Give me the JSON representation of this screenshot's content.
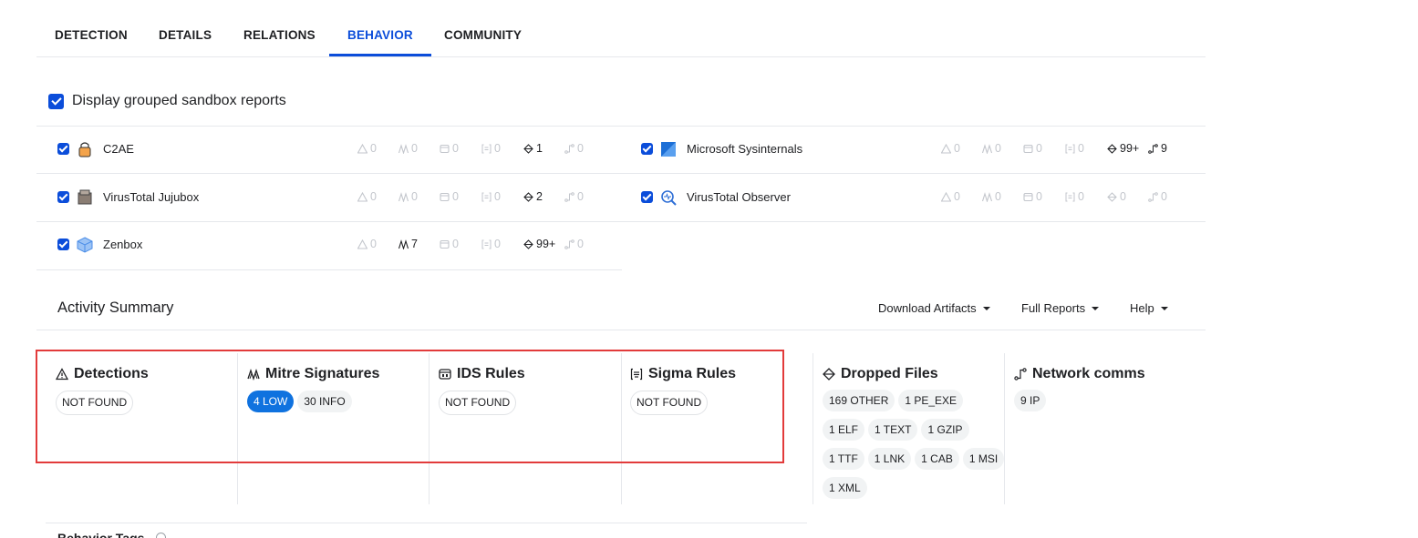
{
  "tabs": [
    {
      "label": "DETECTION",
      "active": false
    },
    {
      "label": "DETAILS",
      "active": false
    },
    {
      "label": "RELATIONS",
      "active": false
    },
    {
      "label": "BEHAVIOR",
      "active": true
    },
    {
      "label": "COMMUNITY",
      "active": false
    }
  ],
  "grouped_reports": {
    "label": "Display grouped sandbox reports",
    "checked": true
  },
  "sandboxes": [
    {
      "name": "C2AE",
      "checked": true,
      "icon": "c2ae-logo-icon",
      "stats": {
        "detections": "0",
        "mitre": "0",
        "ids": "0",
        "sigma": "0",
        "dropped": "1",
        "network": "0"
      }
    },
    {
      "name": "Microsoft Sysinternals",
      "checked": true,
      "icon": "sysinternals-logo-icon",
      "stats": {
        "detections": "0",
        "mitre": "0",
        "ids": "0",
        "sigma": "0",
        "dropped": "99+",
        "network": "9"
      }
    },
    {
      "name": "VirusTotal Jujubox",
      "checked": true,
      "icon": "jujubox-logo-icon",
      "stats": {
        "detections": "0",
        "mitre": "0",
        "ids": "0",
        "sigma": "0",
        "dropped": "2",
        "network": "0"
      }
    },
    {
      "name": "VirusTotal Observer",
      "checked": true,
      "icon": "observer-logo-icon",
      "stats": {
        "detections": "0",
        "mitre": "0",
        "ids": "0",
        "sigma": "0",
        "dropped": "0",
        "network": "0"
      }
    },
    {
      "name": "Zenbox",
      "checked": true,
      "icon": "zenbox-logo-icon",
      "stats": {
        "detections": "0",
        "mitre": "7",
        "ids": "0",
        "sigma": "0",
        "dropped": "99+",
        "network": "0"
      }
    }
  ],
  "activity": {
    "title": "Activity Summary",
    "menus": [
      "Download Artifacts",
      "Full Reports",
      "Help"
    ],
    "columns": {
      "detections": {
        "title": "Detections",
        "pills": [
          "NOT FOUND"
        ]
      },
      "mitre": {
        "title": "Mitre Signatures",
        "pills": [
          "4 LOW",
          "30 INFO"
        ]
      },
      "ids": {
        "title": "IDS Rules",
        "pills": [
          "NOT FOUND"
        ]
      },
      "sigma": {
        "title": "Sigma Rules",
        "pills": [
          "NOT FOUND"
        ]
      },
      "dropped": {
        "title": "Dropped Files",
        "pills": [
          "169 OTHER",
          "1 PE_EXE",
          "1 ELF",
          "1 TEXT",
          "1 GZIP",
          "1 TTF",
          "1 LNK",
          "1 CAB",
          "1 MSI",
          "1 XML"
        ]
      },
      "network": {
        "title": "Network comms",
        "pills": [
          "9 IP"
        ]
      }
    }
  },
  "behavior_tags": {
    "title": "Behavior Tags"
  },
  "colors": {
    "accent": "#0b4dda",
    "pill_low": "#0f72df",
    "highlight_box": "#e23b3b"
  }
}
